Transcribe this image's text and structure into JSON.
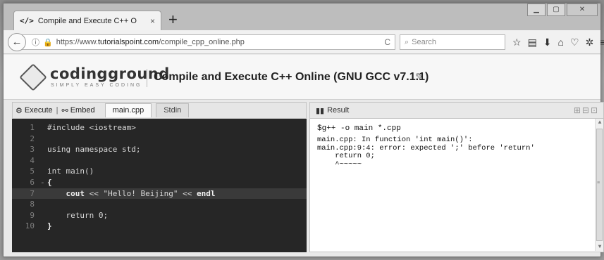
{
  "browser": {
    "tab_title": "Compile and Execute C++ O",
    "tab_icon": "</>",
    "tab_close": "×",
    "new_tab": "+",
    "url_prefix": "https://www.",
    "url_domain": "tutorialspoint.com",
    "url_path": "/compile_cpp_online.php",
    "search_placeholder": "Search"
  },
  "site": {
    "logo_text": "codingground",
    "logo_tagline": "SIMPLY EASY CODING",
    "page_title": "Compile and Execute C++ Online (GNU GCC v7.1.1)"
  },
  "editor_toolbar": {
    "execute_label": "Execute",
    "separator": "|",
    "embed_label": "Embed",
    "file_tab": "main.cpp",
    "stdin_tab": "Stdin"
  },
  "code_lines": [
    {
      "n": "1",
      "fold": "",
      "text": "#include <iostream>"
    },
    {
      "n": "2",
      "fold": "",
      "text": ""
    },
    {
      "n": "3",
      "fold": "",
      "text": "using namespace std;"
    },
    {
      "n": "4",
      "fold": "",
      "text": ""
    },
    {
      "n": "5",
      "fold": "",
      "text": "int main()"
    },
    {
      "n": "6",
      "fold": "-",
      "text": "{"
    },
    {
      "n": "7",
      "fold": "",
      "text": "    cout << \"Hello! Beijing\" << endl"
    },
    {
      "n": "8",
      "fold": "",
      "text": ""
    },
    {
      "n": "9",
      "fold": "",
      "text": "    return 0;"
    },
    {
      "n": "10",
      "fold": "",
      "text": "}"
    }
  ],
  "result": {
    "header": "Result",
    "command": "$g++ -o main *.cpp",
    "output": "main.cpp: In function 'int main()':\nmain.cpp:9:4: error: expected ';' before 'return'\n    return 0;\n    ^~~~~~"
  },
  "colors": {
    "editor_bg": "#262626",
    "active_line": "#3a3a3a"
  }
}
